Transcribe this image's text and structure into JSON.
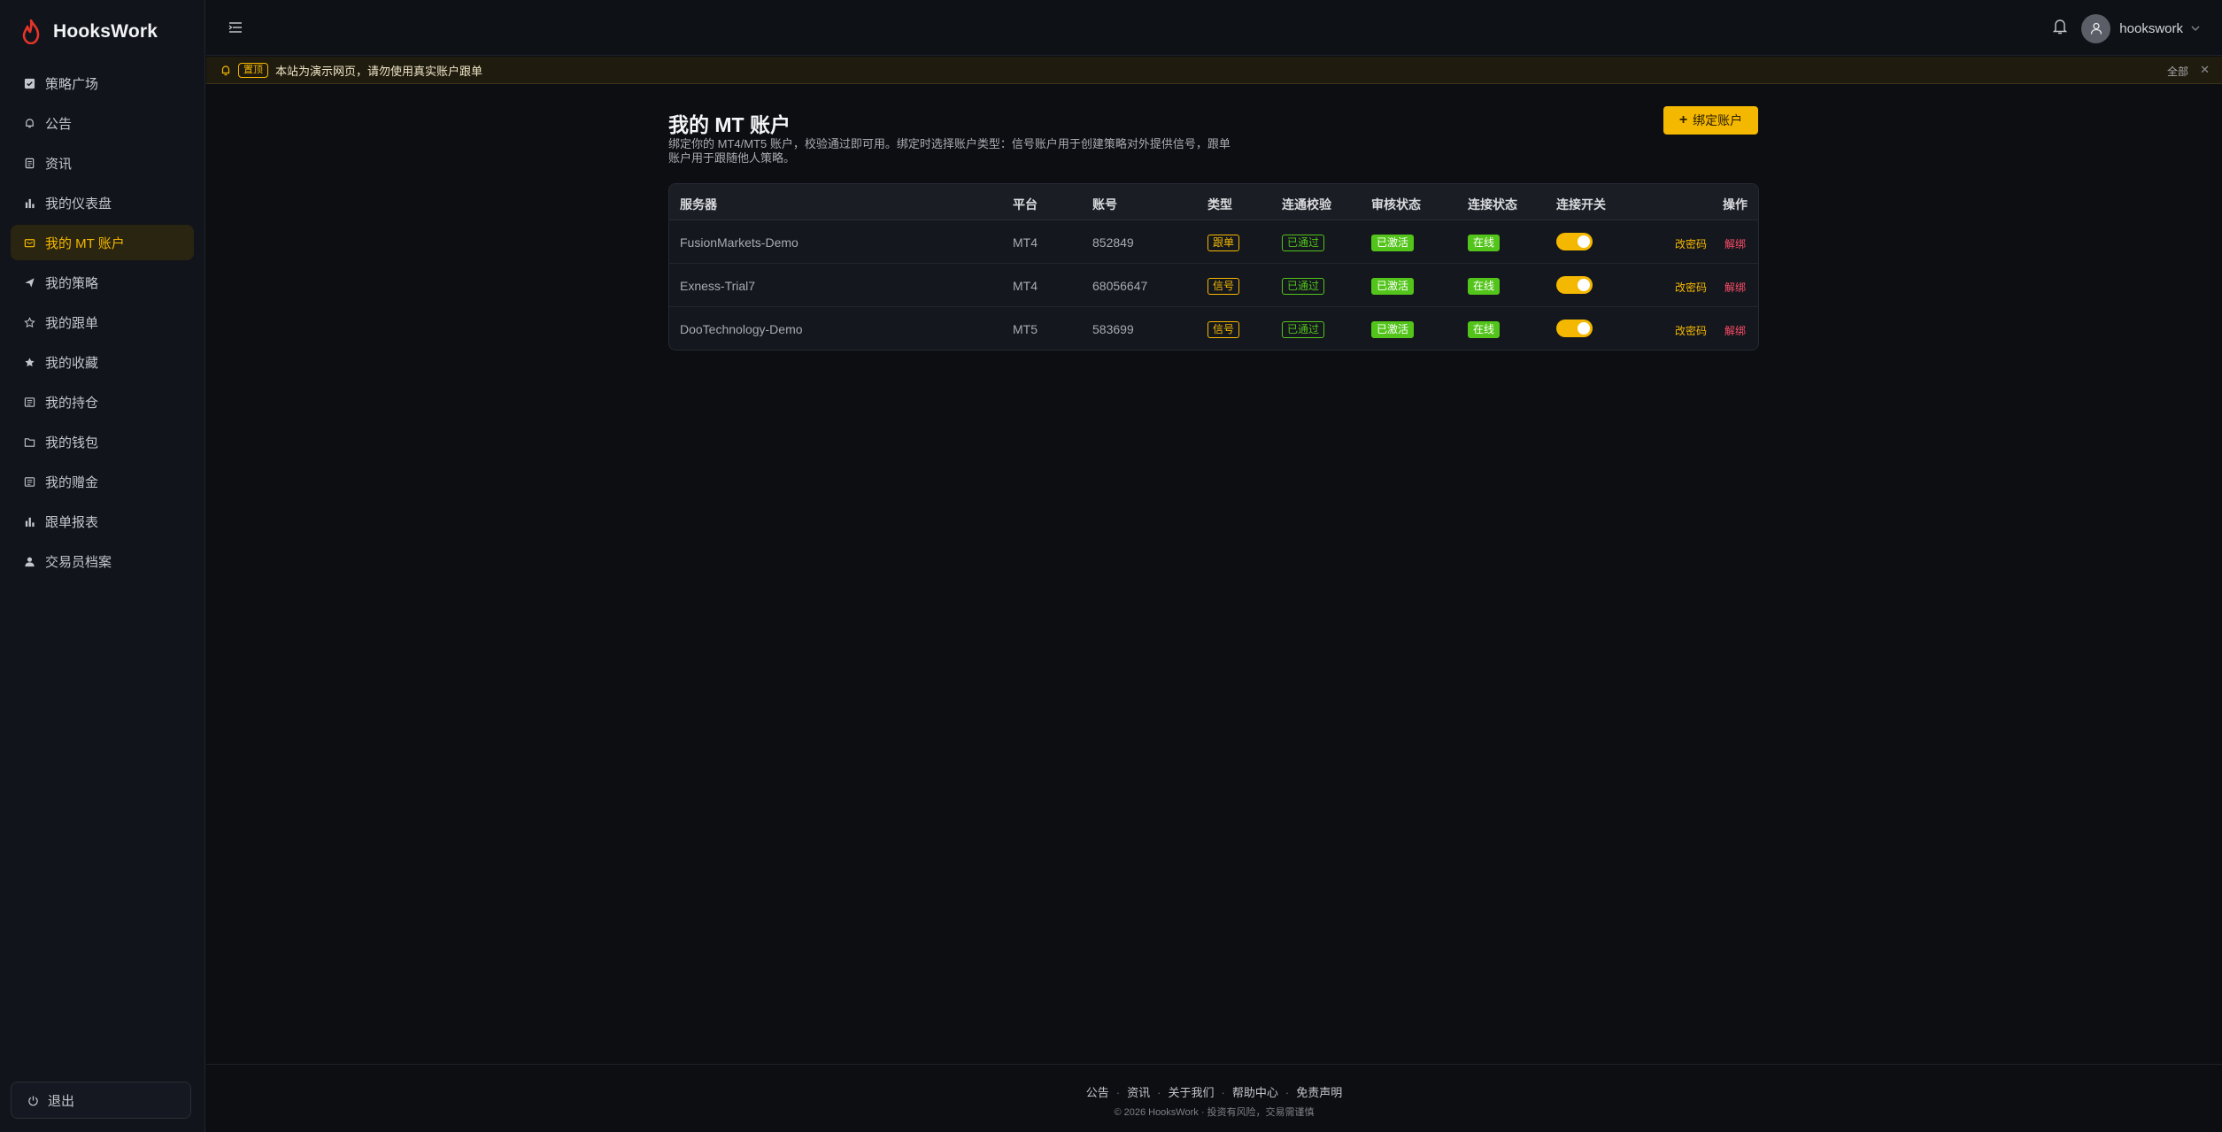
{
  "brand": {
    "name": "HooksWork"
  },
  "sidebar": {
    "items": [
      {
        "label": "策略广场",
        "icon": "checkbox-icon"
      },
      {
        "label": "公告",
        "icon": "bell-icon"
      },
      {
        "label": "资讯",
        "icon": "document-icon"
      },
      {
        "label": "我的仪表盘",
        "icon": "bar-chart-icon"
      },
      {
        "label": "我的 MT 账户",
        "icon": "account-card-icon",
        "active": true
      },
      {
        "label": "我的策略",
        "icon": "send-icon"
      },
      {
        "label": "我的跟单",
        "icon": "star-outline-icon"
      },
      {
        "label": "我的收藏",
        "icon": "star-filled-icon"
      },
      {
        "label": "我的持仓",
        "icon": "list-icon"
      },
      {
        "label": "我的钱包",
        "icon": "folder-icon"
      },
      {
        "label": "我的赠金",
        "icon": "list-icon"
      },
      {
        "label": "跟单报表",
        "icon": "bar-chart-icon"
      },
      {
        "label": "交易员档案",
        "icon": "user-icon"
      }
    ],
    "logout_label": "退出"
  },
  "header": {
    "username": "hookswork"
  },
  "notice": {
    "badge": "置顶",
    "text": "本站为演示网页，请勿使用真实账户跟单",
    "all_label": "全部",
    "close_label": "✕"
  },
  "page": {
    "title": "我的 MT 账户",
    "description": "绑定你的 MT4/MT5 账户，校验通过即可用。绑定时选择账户类型：信号账户用于创建策略对外提供信号，跟单账户用于跟随他人策略。",
    "bind_button": "绑定账户"
  },
  "table": {
    "headers": {
      "server": "服务器",
      "platform": "平台",
      "account": "账号",
      "type": "类型",
      "verify": "连通校验",
      "review": "审核状态",
      "conn": "连接状态",
      "switch": "连接开关",
      "ops": "操作"
    },
    "rows": [
      {
        "server": "FusionMarkets-Demo",
        "platform": "MT4",
        "account": "852849",
        "type": "跟单",
        "verify": "已通过",
        "review": "已激活",
        "conn": "在线",
        "switch_on": true,
        "edit": "改密码",
        "unbind": "解绑"
      },
      {
        "server": "Exness-Trial7",
        "platform": "MT4",
        "account": "68056647",
        "type": "信号",
        "verify": "已通过",
        "review": "已激活",
        "conn": "在线",
        "switch_on": true,
        "edit": "改密码",
        "unbind": "解绑"
      },
      {
        "server": "DooTechnology-Demo",
        "platform": "MT5",
        "account": "583699",
        "type": "信号",
        "verify": "已通过",
        "review": "已激活",
        "conn": "在线",
        "switch_on": true,
        "edit": "改密码",
        "unbind": "解绑"
      }
    ]
  },
  "footer": {
    "links": [
      "公告",
      "资讯",
      "关于我们",
      "帮助中心",
      "免责声明"
    ],
    "copyright": "© 2026 HooksWork · 投资有风险，交易需谨慎"
  },
  "colors": {
    "accent": "#f5b800",
    "success": "#52c41a",
    "danger": "#ff4d6a"
  }
}
